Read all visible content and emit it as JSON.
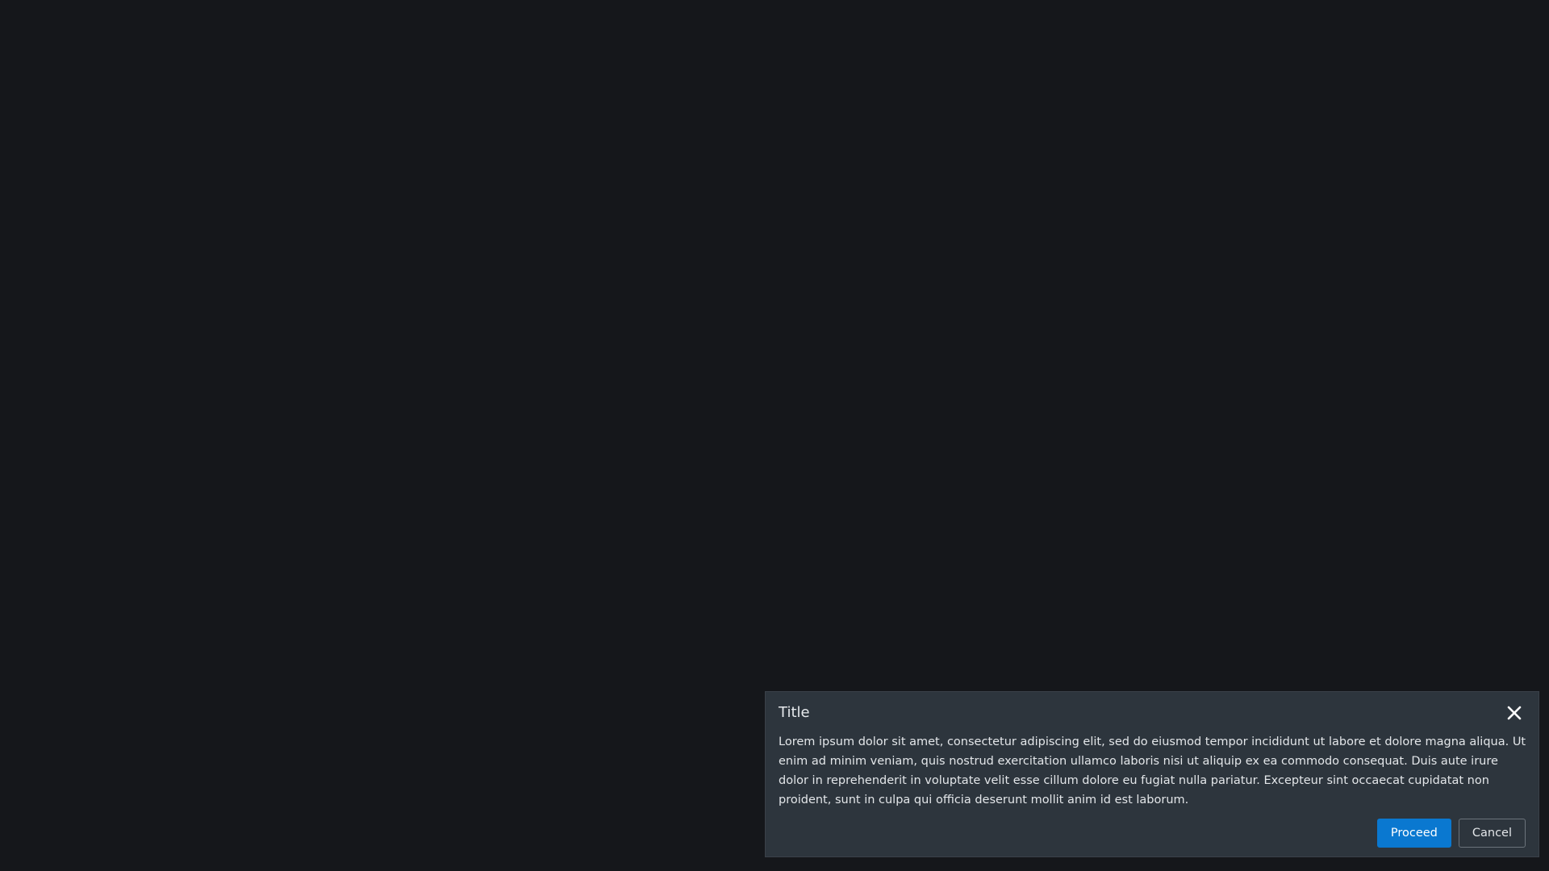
{
  "dialog": {
    "title": "Title",
    "body": "Lorem ipsum dolor sit amet, consectetur adipiscing elit, sed do eiusmod tempor incididunt ut labore et dolore magna aliqua. Ut enim ad minim veniam, quis nostrud exercitation ullamco laboris nisi ut aliquip ex ea commodo consequat. Duis aute irure dolor in reprehenderit in voluptate velit esse cillum dolore eu fugiat nulla pariatur. Excepteur sint occaecat cupidatat non proident, sunt in culpa qui officia deserunt mollit anim id est laborum.",
    "close_icon": "close-icon",
    "proceed_label": "Proceed",
    "cancel_label": "Cancel"
  },
  "colors": {
    "background": "#15171b",
    "dialog_background": "#2d353d",
    "primary_button": "#0a78d0"
  }
}
